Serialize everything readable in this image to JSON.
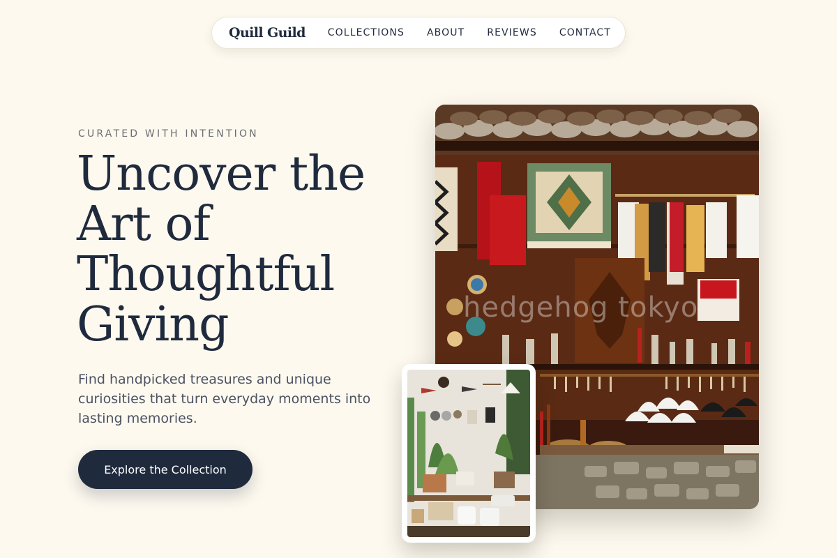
{
  "nav": {
    "brand": "Quill Guild",
    "links": [
      "COLLECTIONS",
      "ABOUT",
      "REVIEWS",
      "CONTACT"
    ]
  },
  "hero": {
    "eyebrow": "CURATED WITH INTENTION",
    "headline": "Uncover the Art of Thoughtful Giving",
    "lede": "Find handpicked treasures and unique curiosities that turn everyday moments into lasting memories.",
    "cta_label": "Explore the Collection"
  },
  "images": {
    "main_watermark": "hedgehog tokyo"
  },
  "colors": {
    "background": "#fdf9ef",
    "ink": "#1f2a3d",
    "muted": "#6b6d72",
    "button": "#1f2a3d"
  }
}
